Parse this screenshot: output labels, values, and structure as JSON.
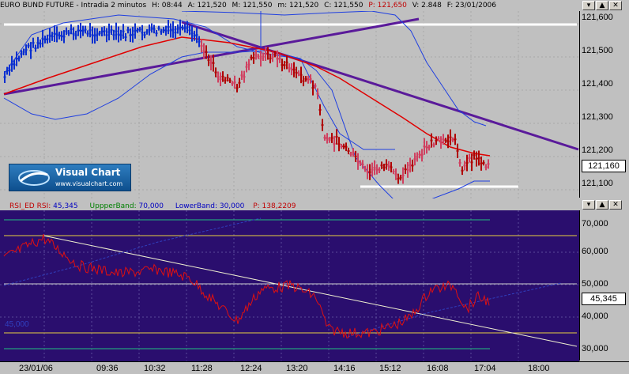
{
  "header": {
    "title": "EURO BUND FUTURE - Intradia 2 minutos",
    "h": "H: 08:44",
    "a": "A: 121,520",
    "m": "M: 121,550",
    "mm": "m: 121,520",
    "c": "C: 121,550",
    "change": "P: 121,650",
    "v": "V: 2.848",
    "f": "F: 23/01/2006"
  },
  "window_buttons": {
    "minimize": "▾",
    "up": "▲",
    "close": "✕"
  },
  "price_axis": {
    "ticks": [
      "121,600",
      "121,500",
      "121,400",
      "121,300",
      "121,200",
      "121,100"
    ],
    "current": "121,160"
  },
  "rsi_header": {
    "rsi": "RSI_ED RSI:",
    "rsi_val": "45,345",
    "upper": "UppperBand:",
    "upper_val": "70,000",
    "lower": "LowerBand:",
    "lower_val": "30,000",
    "p": "P: 138,2209"
  },
  "rsi_axis": {
    "ticks": [
      "70,000",
      "60,000",
      "50,000",
      "40,000",
      "30,000"
    ],
    "current": "45,345",
    "left_label": "45,000"
  },
  "time_axis": [
    "23/01/06",
    "09:36",
    "10:32",
    "11:28",
    "12:24",
    "13:20",
    "14:16",
    "15:12",
    "16:08",
    "17:04",
    "18:00"
  ],
  "logo": {
    "title": "Visual Chart",
    "url": "www.visualchart.com"
  },
  "colors": {
    "price_bg": "#c0c0c0",
    "rsi_bg": "#2a0e6e",
    "candle_up": "#0a2fd0",
    "candle_down": "#b00000",
    "bollinger": "#1f3fe0",
    "ma": "#e00000",
    "trendline": "#5a1a9a",
    "rsi_line": "#e01010",
    "yellow_band": "#e8d040",
    "green_band": "#20c080"
  }
}
